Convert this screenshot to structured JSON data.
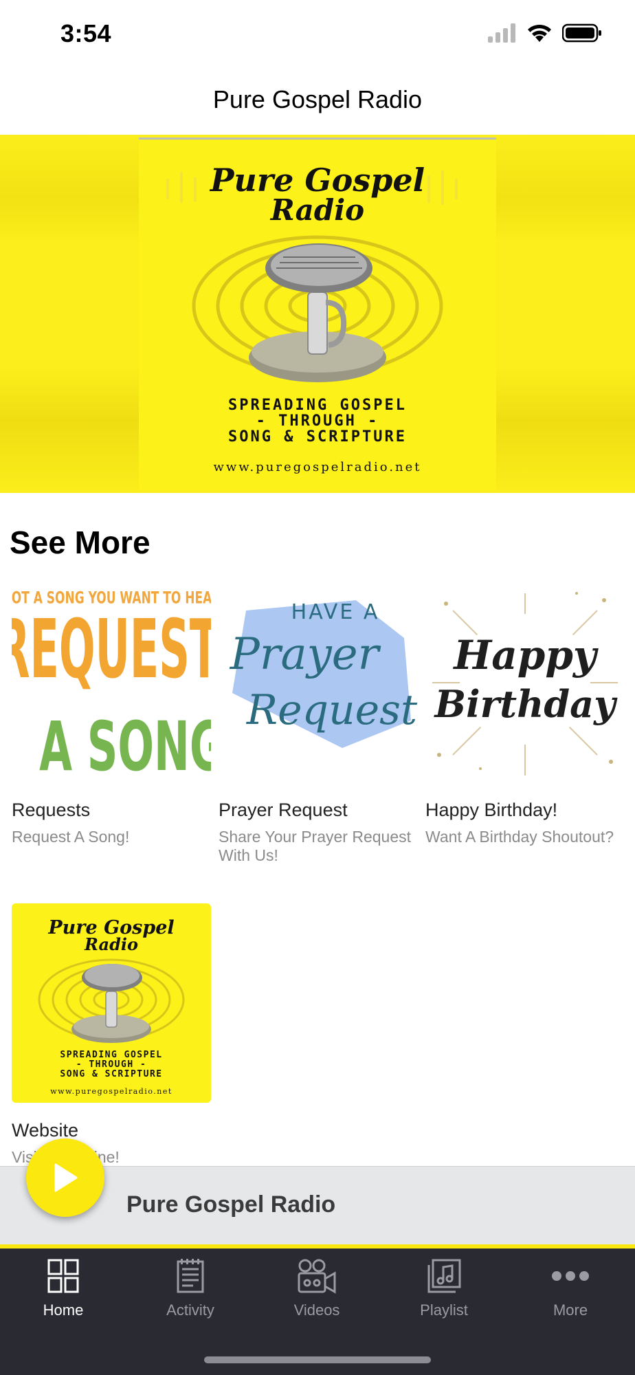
{
  "status": {
    "time": "3:54"
  },
  "nav": {
    "title": "Pure Gospel Radio"
  },
  "hero": {
    "logo_line1": "Pure Gospel",
    "logo_line2": "Radio",
    "tagline1": "SPREADING GOSPEL",
    "tagline2": "- THROUGH -",
    "tagline3": "SONG & SCRIPTURE",
    "url": "www.puregospelradio.net"
  },
  "section": {
    "title": "See More"
  },
  "tiles": [
    {
      "title": "Requests",
      "subtitle": "Request A Song!",
      "art_top": "GOT A SONG YOU WANT TO HEAR?",
      "art_line1": "REQUEST",
      "art_line2": "A SONG"
    },
    {
      "title": "Prayer Request",
      "subtitle": "Share Your Prayer Request With Us!",
      "art_top": "HAVE A",
      "art_line1": "Prayer",
      "art_line2": "Request"
    },
    {
      "title": "Happy Birthday!",
      "subtitle": "Want A Birthday Shoutout?",
      "art_line1": "Happy",
      "art_line2": "Birthday"
    },
    {
      "title": "Website",
      "subtitle": "Visit Us Online!",
      "art_line1": "Pure Gospel",
      "art_line2": "Radio",
      "tag1": "SPREADING GOSPEL",
      "tag2": "- THROUGH -",
      "tag3": "SONG & SCRIPTURE",
      "url": "www.puregospelradio.net"
    }
  ],
  "player": {
    "title": "Pure Gospel Radio"
  },
  "tabs": [
    {
      "label": "Home",
      "icon": "grid-icon",
      "active": true
    },
    {
      "label": "Activity",
      "icon": "notepad-icon",
      "active": false
    },
    {
      "label": "Videos",
      "icon": "video-camera-icon",
      "active": false
    },
    {
      "label": "Playlist",
      "icon": "music-note-icon",
      "active": false
    },
    {
      "label": "More",
      "icon": "ellipsis-icon",
      "active": false
    }
  ],
  "colors": {
    "brand_yellow": "#fbe80f",
    "tabbar": "#2a2a33"
  }
}
